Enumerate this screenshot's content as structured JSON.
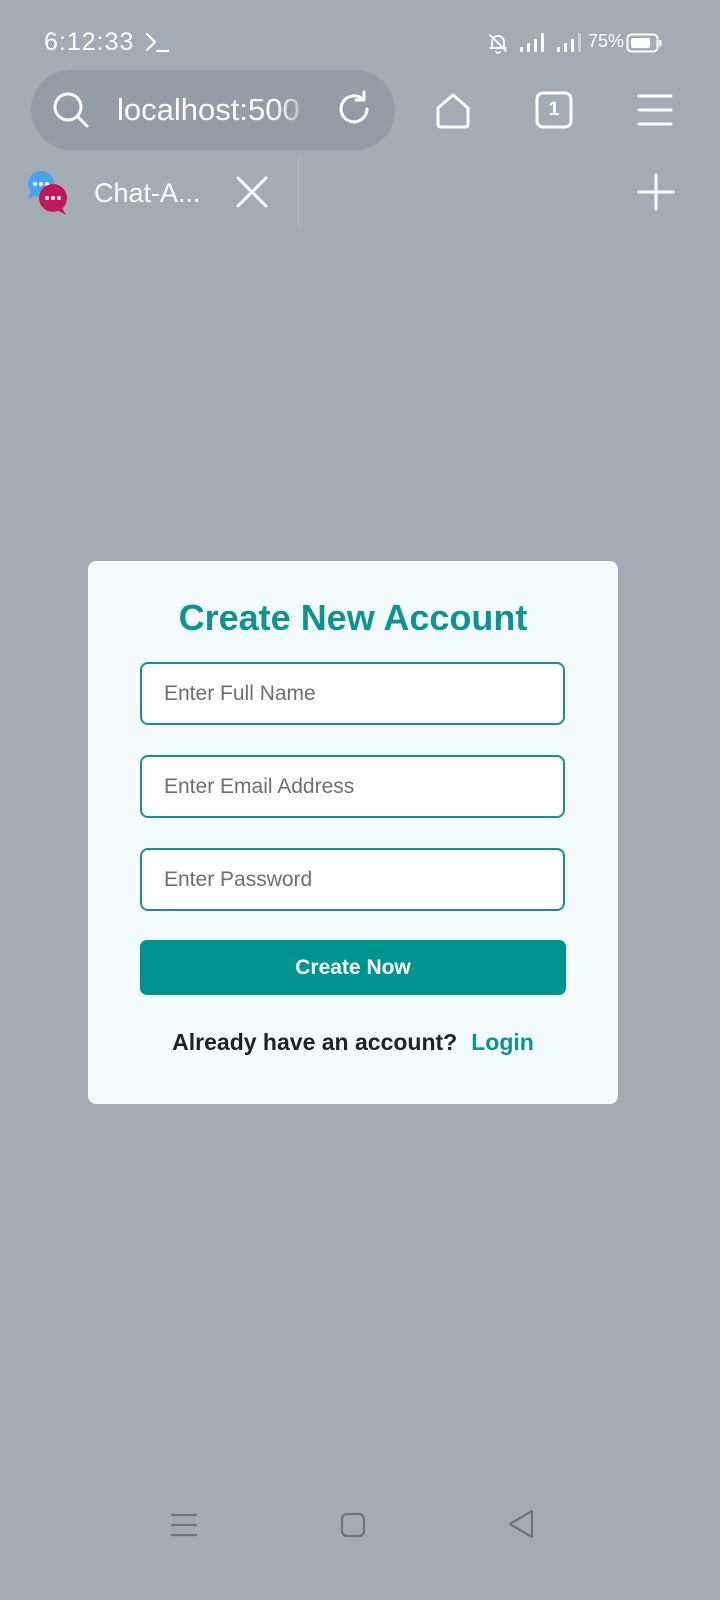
{
  "status_bar": {
    "time": "6:12:33",
    "battery_percent": "75%",
    "icons": [
      "terminal-icon",
      "bell-off-icon",
      "signal-icon",
      "signal-icon",
      "battery-icon"
    ]
  },
  "browser": {
    "url": "localhost:500",
    "tab_count": "1",
    "tab": {
      "title": "Chat-A..."
    },
    "icons": [
      "search-icon",
      "reload-icon",
      "home-icon",
      "tabs-icon",
      "menu-icon",
      "close-icon",
      "plus-icon"
    ]
  },
  "form": {
    "title": "Create New Account",
    "fields": {
      "name_placeholder": "Enter Full Name",
      "email_placeholder": "Enter Email Address",
      "password_placeholder": "Enter Password",
      "name_value": "",
      "email_value": "",
      "password_value": ""
    },
    "submit_label": "Create Now",
    "login_prompt": "Already have an account?",
    "login_label": "Login"
  },
  "colors": {
    "page_background": "#a3abb3",
    "accent": "#009491",
    "card_background": "#f3fbfc"
  },
  "nav_bar": {
    "icons": [
      "recents-icon",
      "home-icon",
      "back-icon"
    ]
  }
}
